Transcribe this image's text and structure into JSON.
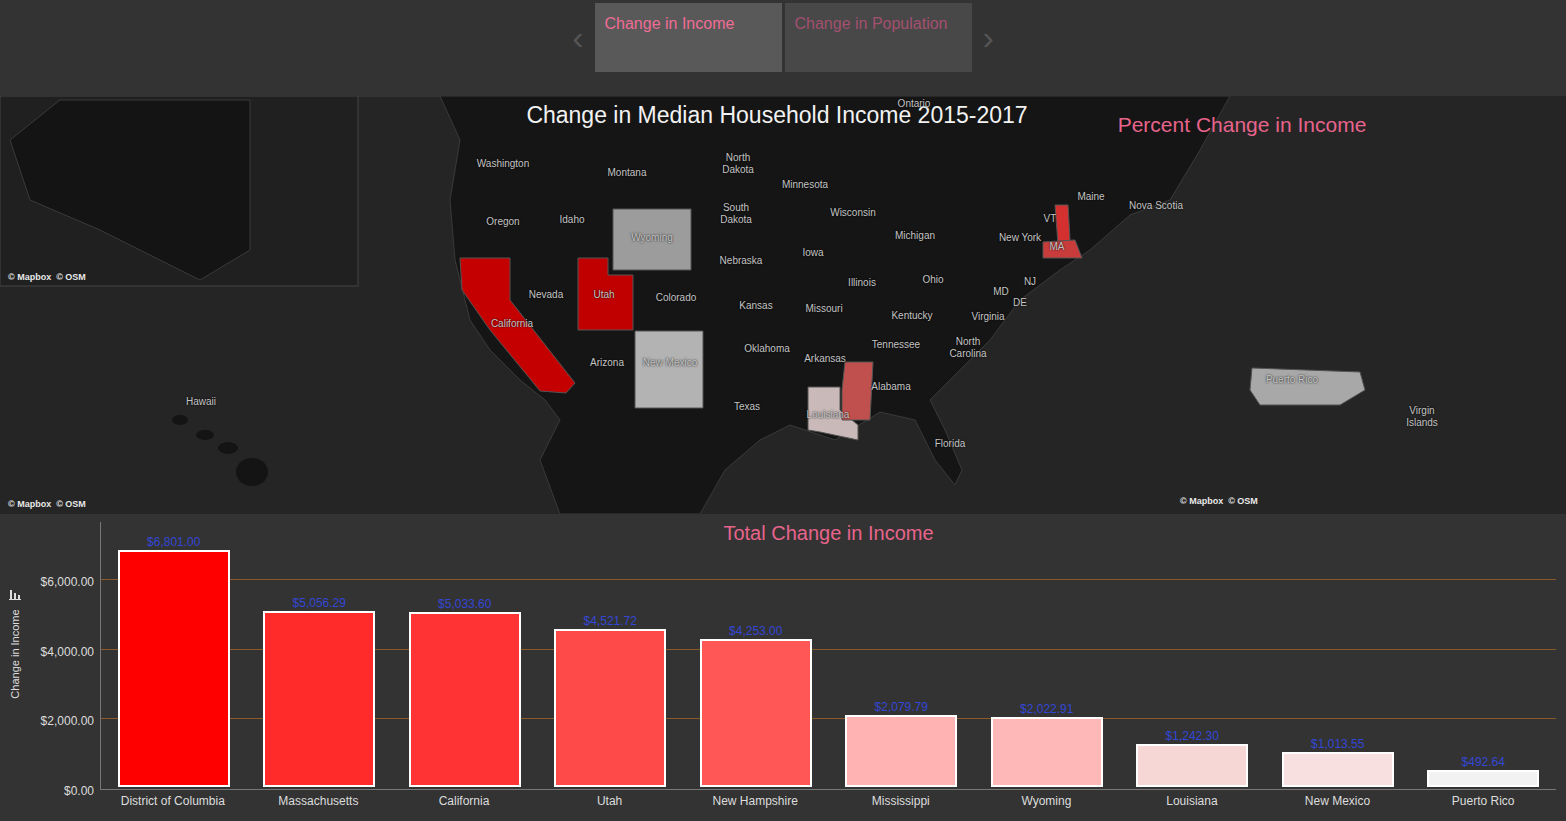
{
  "tabs": {
    "prev": "‹",
    "next": "›",
    "items": [
      {
        "label": "Change in Income",
        "selected": true
      },
      {
        "label": "Change in Population",
        "selected": false
      }
    ]
  },
  "map": {
    "title": "Change in Median Household Income 2015-2017",
    "subtitle": "Percent Change in Income",
    "labels": [
      "Ontario",
      "Washington",
      "Montana",
      "North Dakota",
      "Minnesota",
      "South Dakota",
      "Wisconsin",
      "Michigan",
      "Maine",
      "Nova Scotia",
      "VT",
      "New York",
      "MA",
      "Oregon",
      "Idaho",
      "Wyoming",
      "Nebraska",
      "Iowa",
      "Illinois",
      "Ohio",
      "NJ",
      "MD",
      "DE",
      "Nevada",
      "Utah",
      "Colorado",
      "Kansas",
      "Missouri",
      "Kentucky",
      "Virginia",
      "California",
      "Tennessee",
      "North Carolina",
      "Arizona",
      "New Mexico",
      "Oklahoma",
      "Arkansas",
      "Alabama",
      "Texas",
      "Louisiana",
      "Florida",
      "Hawaii",
      "Puerto Rico",
      "Virgin Islands"
    ],
    "regions": [
      {
        "name": "California",
        "color": "#c40000"
      },
      {
        "name": "Utah",
        "color": "#c00000"
      },
      {
        "name": "Wyoming",
        "color": "#9c9c9c"
      },
      {
        "name": "New Mexico",
        "color": "#b3b3b3"
      },
      {
        "name": "Louisiana",
        "color": "#c9b9b9"
      },
      {
        "name": "Mississippi",
        "color": "#c0504d"
      },
      {
        "name": "New Hampshire",
        "color": "#d43030"
      },
      {
        "name": "Massachusetts",
        "color": "#c83c3c"
      },
      {
        "name": "Puerto Rico",
        "color": "#a8a8a8"
      }
    ],
    "attributions": [
      {
        "mapbox": "© Mapbox",
        "osm": "© OSM"
      },
      {
        "mapbox": "© Mapbox",
        "osm": "© OSM"
      },
      {
        "mapbox": "© Mapbox",
        "osm": "© OSM"
      }
    ]
  },
  "chart": {
    "title": "Total Change in Income",
    "y_axis_title": "Change in Income",
    "y_ticks": [
      {
        "label": "$0.00",
        "value": 0
      },
      {
        "label": "$2,000.00",
        "value": 2000
      },
      {
        "label": "$4,000.00",
        "value": 4000
      },
      {
        "label": "$6,000.00",
        "value": 6000
      }
    ],
    "categories": [
      "District of Columbia",
      "Massachusetts",
      "California",
      "Utah",
      "New Hampshire",
      "Mississippi",
      "Wyoming",
      "Louisiana",
      "New Mexico",
      "Puerto Rico"
    ],
    "values": [
      6801.0,
      5056.29,
      5033.6,
      4521.72,
      4253.0,
      2079.79,
      2022.91,
      1242.3,
      1013.55,
      492.64
    ],
    "value_labels": [
      "$6,801.00",
      "$5,056.29",
      "$5,033.60",
      "$4,521.72",
      "$4,253.00",
      "$2,079.79",
      "$2,022.91",
      "$1,242.30",
      "$1,013.55",
      "$492.64"
    ],
    "colors": [
      "#ff0000",
      "#ff2b2b",
      "#ff3333",
      "#ff4a4a",
      "#ff5656",
      "#ffb3b3",
      "#ffb8b8",
      "#f7d6d6",
      "#f8e0e0",
      "#f2f2f2"
    ]
  }
}
